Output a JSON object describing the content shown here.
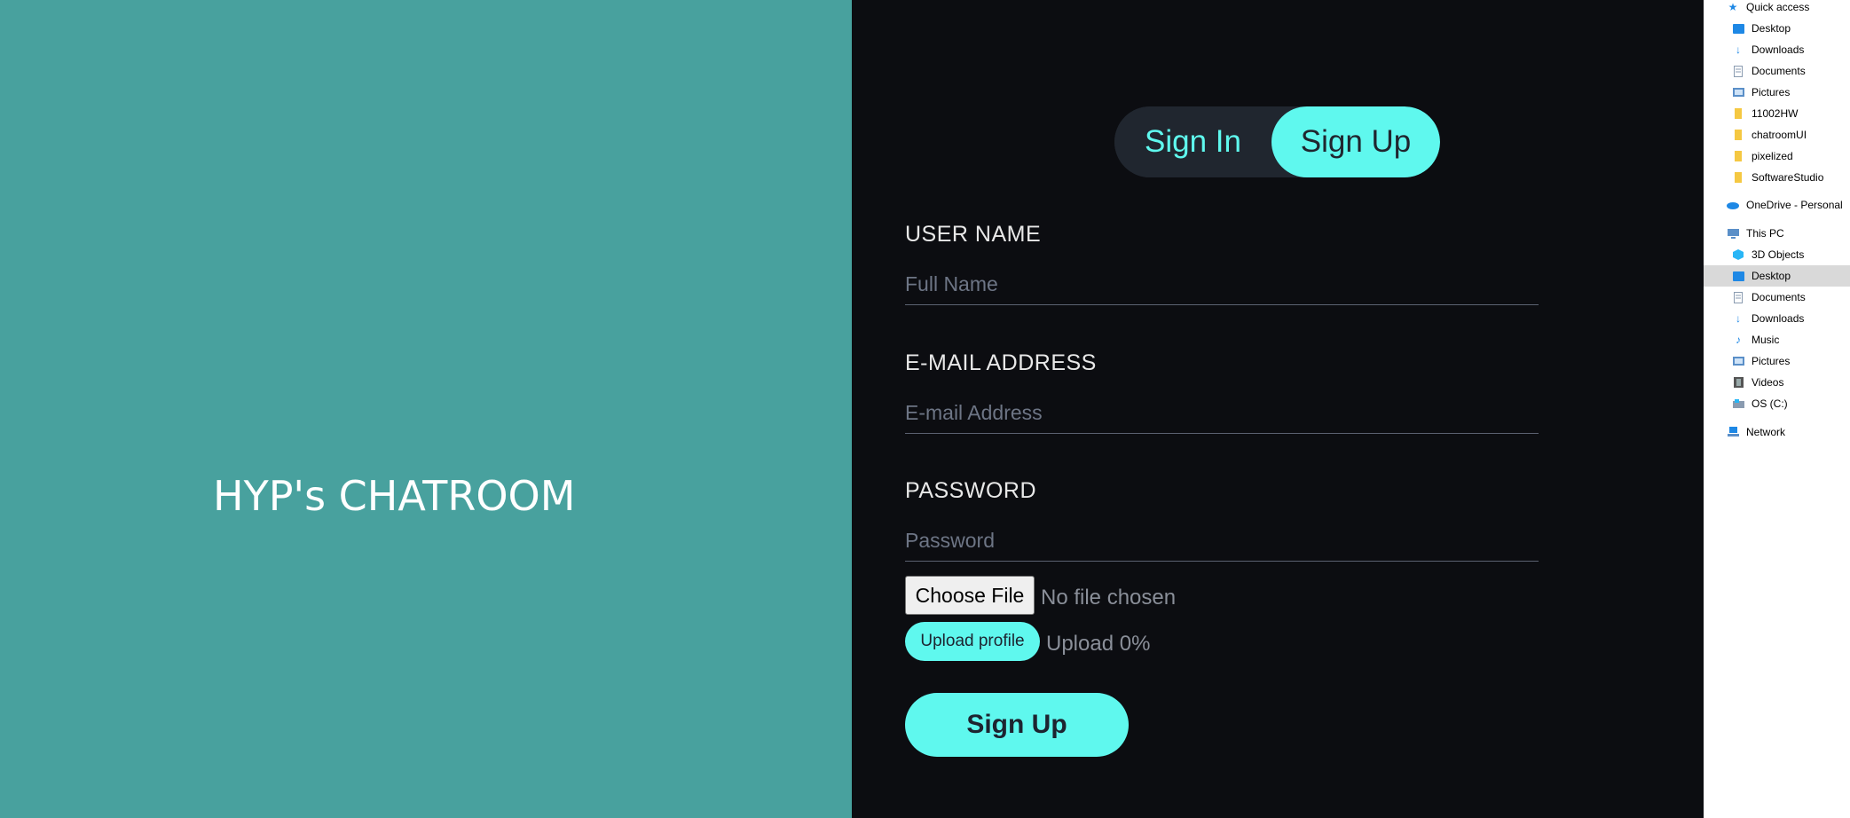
{
  "brand": {
    "title": "HYP's CHATROOM"
  },
  "auth_toggle": {
    "sign_in": "Sign In",
    "sign_up": "Sign Up",
    "active": "Sign Up"
  },
  "form": {
    "username": {
      "label": "USER NAME",
      "placeholder": "Full Name",
      "value": ""
    },
    "email": {
      "label": "E-MAIL ADDRESS",
      "placeholder": "E-mail Address",
      "value": ""
    },
    "password": {
      "label": "PASSWORD",
      "placeholder": "Password",
      "value": ""
    },
    "file": {
      "button": "Choose File",
      "status": "No file chosen"
    },
    "upload": {
      "button": "Upload profile",
      "progress": "Upload 0%"
    },
    "submit": "Sign Up"
  },
  "explorer": {
    "selected": "Desktop (This PC)",
    "items": [
      {
        "label": "Quick access",
        "icon": "star-icon",
        "color": "#1e88e5"
      },
      {
        "label": "Desktop",
        "icon": "desktop-folder-icon",
        "color": "#1e88e5"
      },
      {
        "label": "Downloads",
        "icon": "download-arrow-icon",
        "color": "#1e88e5"
      },
      {
        "label": "Documents",
        "icon": "documents-icon",
        "color": "#8a9bb0"
      },
      {
        "label": "Pictures",
        "icon": "pictures-icon",
        "color": "#5a8fc8"
      },
      {
        "label": "11002HW",
        "icon": "folder-icon",
        "color": "#f5c842"
      },
      {
        "label": "chatroomUI",
        "icon": "folder-icon",
        "color": "#f5c842"
      },
      {
        "label": "pixelized",
        "icon": "folder-icon",
        "color": "#f5c842"
      },
      {
        "label": "SoftwareStudio",
        "icon": "folder-icon",
        "color": "#f5c842"
      },
      {
        "label": "OneDrive - Personal",
        "icon": "cloud-icon",
        "color": "#1e88e5"
      },
      {
        "label": "This PC",
        "icon": "computer-icon",
        "color": "#5a8fc8"
      },
      {
        "label": "3D Objects",
        "icon": "cube-icon",
        "color": "#29b6f6"
      },
      {
        "label": "Desktop",
        "icon": "desktop-folder-icon",
        "color": "#1e88e5"
      },
      {
        "label": "Documents",
        "icon": "documents-icon",
        "color": "#8a9bb0"
      },
      {
        "label": "Downloads",
        "icon": "download-arrow-icon",
        "color": "#1e88e5"
      },
      {
        "label": "Music",
        "icon": "music-note-icon",
        "color": "#1e88e5"
      },
      {
        "label": "Pictures",
        "icon": "pictures-icon",
        "color": "#5a8fc8"
      },
      {
        "label": "Videos",
        "icon": "film-icon",
        "color": "#555555"
      },
      {
        "label": "OS (C:)",
        "icon": "drive-icon",
        "color": "#8a9bb0"
      },
      {
        "label": "Network",
        "icon": "network-icon",
        "color": "#1e88e5"
      }
    ]
  },
  "colors": {
    "left_panel": "#48a19e",
    "right_panel": "#0c0d11",
    "accent": "#5ff8ee",
    "toggle_inactive": "#20262f"
  }
}
